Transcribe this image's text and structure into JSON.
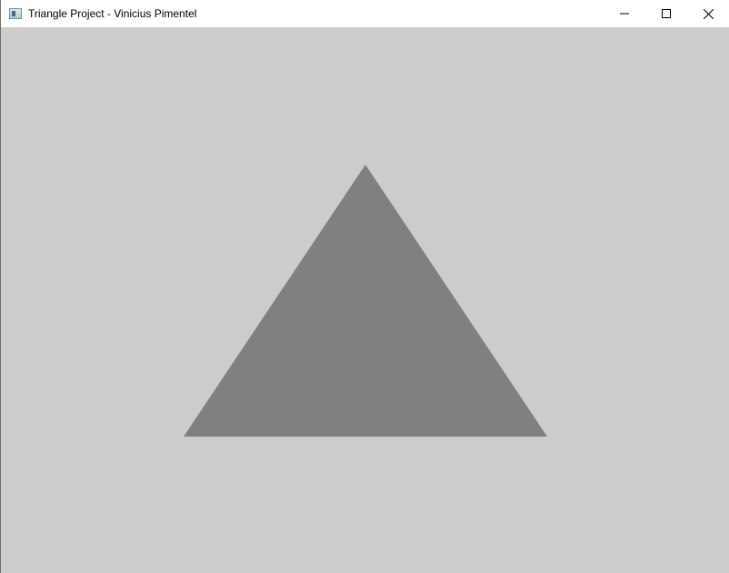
{
  "window": {
    "title": "Triangle Project - Vinicius Pimentel",
    "app_icon": "window-app-icon",
    "controls": [
      "minimize-icon",
      "maximize-icon",
      "close-icon"
    ]
  },
  "scene": {
    "background_color": "#cccccc",
    "shape": "triangle",
    "fill_color": "#808080"
  }
}
